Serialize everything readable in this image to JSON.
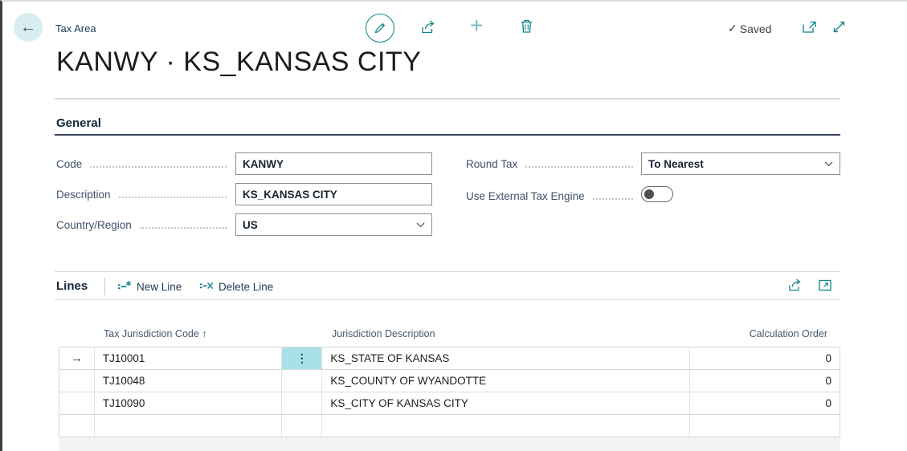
{
  "header": {
    "caption": "Tax Area",
    "saved": "Saved"
  },
  "title": "KANWY · KS_KANSAS CITY",
  "icons": {
    "back": "←",
    "checkmark": "✓",
    "plus": "+",
    "sort_ascending": "↑",
    "row_indicator": "→",
    "ellipsis": "⋮"
  },
  "general": {
    "heading": "General",
    "code_label": "Code",
    "code_value": "KANWY",
    "description_label": "Description",
    "description_value": "KS_KANSAS CITY",
    "country_label": "Country/Region",
    "country_value": "US",
    "round_tax_label": "Round Tax",
    "round_tax_value": "To Nearest",
    "external_engine_label": "Use External Tax Engine",
    "external_engine_state": "off"
  },
  "lines": {
    "heading": "Lines",
    "new_line_label": "New Line",
    "delete_line_label": "Delete Line",
    "table": {
      "col_code": "Tax Jurisdiction Code",
      "col_description": "Jurisdiction Description",
      "col_calc_order": "Calculation Order",
      "sort_column": "Tax Jurisdiction Code",
      "sort_direction": "ascending",
      "rows": [
        {
          "code": "TJ10001",
          "description": "KS_STATE OF KANSAS",
          "calc_order": "0",
          "selected": true
        },
        {
          "code": "TJ10048",
          "description": "KS_COUNTY OF WYANDOTTE",
          "calc_order": "0",
          "selected": false
        },
        {
          "code": "TJ10090",
          "description": "KS_CITY OF KANSAS CITY",
          "calc_order": "0",
          "selected": false
        }
      ]
    }
  },
  "colors": {
    "accent": "#0e8387",
    "accent_light": "#79bcc3",
    "selection_cell": "#a9e1e9",
    "back_circle": "#d8edf0",
    "section_underline": "#36445a"
  }
}
